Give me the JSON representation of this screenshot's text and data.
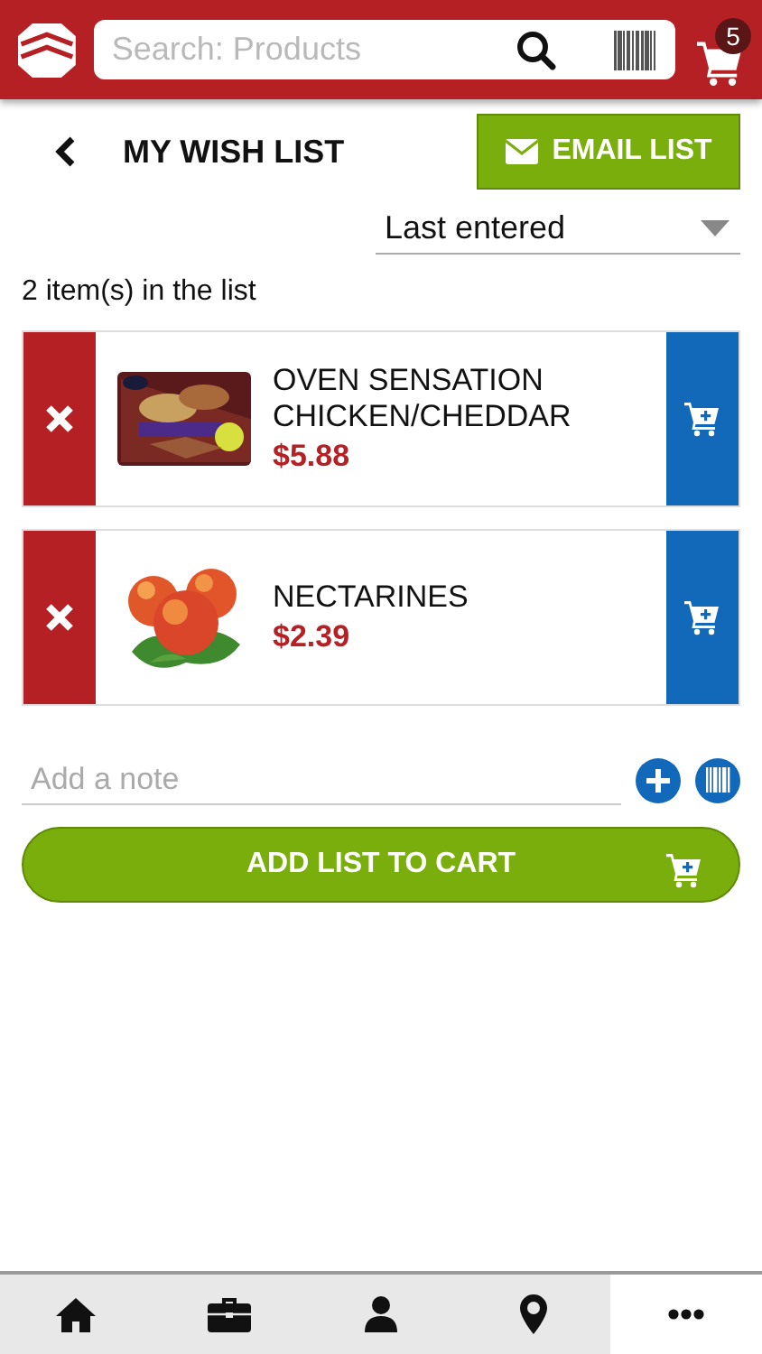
{
  "header": {
    "search": {
      "placeholder": "Search: Products"
    },
    "cart_count": "5"
  },
  "title": "MY WISH LIST",
  "email_button": "EMAIL LIST",
  "sort": {
    "value": "Last entered"
  },
  "count_text": "2 item(s) in the list",
  "items": [
    {
      "name": "OVEN SENSATION CHICKEN/CHEDDAR",
      "price": "$5.88"
    },
    {
      "name": "NECTARINES",
      "price": "$2.39"
    }
  ],
  "note": {
    "placeholder": "Add a note"
  },
  "add_button": "ADD LIST TO CART",
  "nav": [
    {
      "kind": "home",
      "selected": false
    },
    {
      "kind": "briefcase",
      "selected": false
    },
    {
      "kind": "person",
      "selected": false
    },
    {
      "kind": "pin",
      "selected": false
    },
    {
      "kind": "more",
      "selected": true
    }
  ]
}
